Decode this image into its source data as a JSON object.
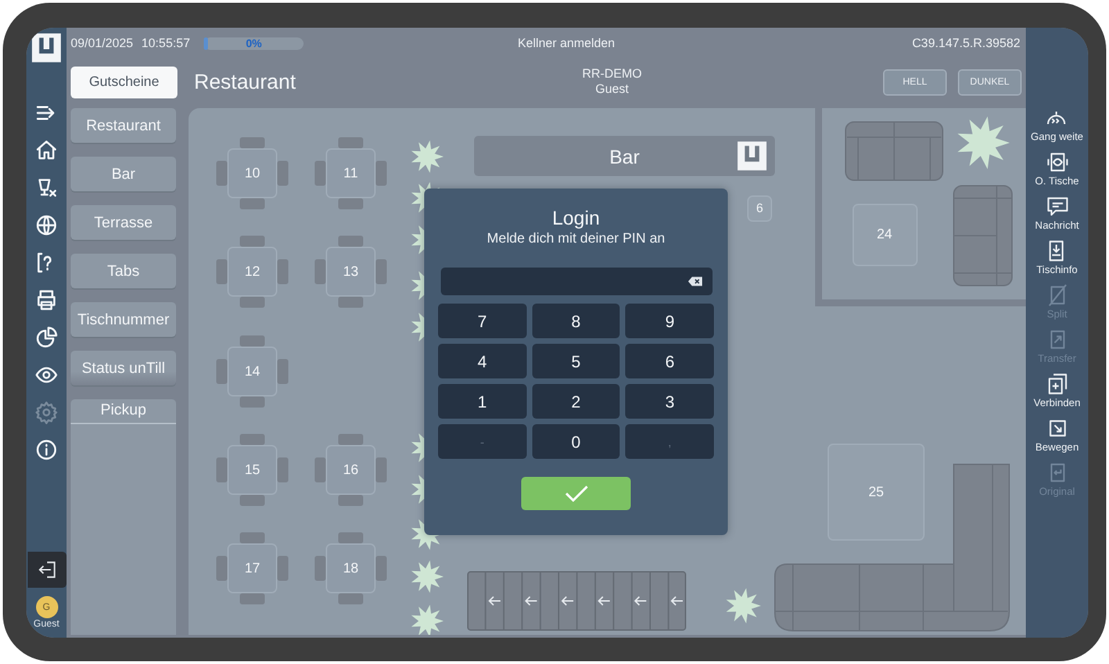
{
  "status_bar": {
    "date": "09/01/2025",
    "time": "10:55:57",
    "progress": {
      "label": "0%",
      "level": 0
    },
    "title": "Kellner anmelden",
    "version": "C39.147.5.R.39582"
  },
  "header": {
    "voucher_button": "Gutscheine",
    "area_title": "Restaurant",
    "company": "RR-DEMO",
    "user": "Guest",
    "theme_buttons": [
      {
        "label": "HELL"
      },
      {
        "label": "DUNKEL"
      }
    ]
  },
  "left_rail": {
    "items": [
      {
        "disabled": false
      },
      {
        "disabled": false
      },
      {
        "disabled": false
      },
      {
        "disabled": false
      },
      {
        "disabled": false
      },
      {
        "disabled": false
      },
      {
        "disabled": false
      },
      {
        "disabled": false
      },
      {
        "disabled": true
      },
      {
        "disabled": false
      }
    ],
    "user": {
      "initial": "G",
      "name": "Guest"
    }
  },
  "areas": [
    {
      "label": "Restaurant"
    },
    {
      "label": "Bar"
    },
    {
      "label": "Terrasse"
    },
    {
      "label": "Tabs"
    },
    {
      "label": "Tischnummer"
    },
    {
      "label": "Status unTill"
    }
  ],
  "pickup": {
    "title": "Pickup"
  },
  "floor": {
    "bar_label": "Bar",
    "tables": [
      {
        "label": "10",
        "kind": "four-seat"
      },
      {
        "label": "11",
        "kind": "four-seat"
      },
      {
        "label": "12",
        "kind": "four-seat"
      },
      {
        "label": "13",
        "kind": "four-seat"
      },
      {
        "label": "14",
        "kind": "four-seat"
      },
      {
        "label": "15",
        "kind": "four-seat"
      },
      {
        "label": "16",
        "kind": "four-seat"
      },
      {
        "label": "17",
        "kind": "four-seat"
      },
      {
        "label": "18",
        "kind": "four-seat"
      },
      {
        "label": "6",
        "kind": "small"
      },
      {
        "label": "24",
        "kind": "plain"
      },
      {
        "label": "25",
        "kind": "plain"
      }
    ]
  },
  "login": {
    "title": "Login",
    "subtitle": "Melde dich mit deiner PIN an",
    "keys": [
      {
        "label": "7",
        "disabled": false
      },
      {
        "label": "8",
        "disabled": false
      },
      {
        "label": "9",
        "disabled": false
      },
      {
        "label": "4",
        "disabled": false
      },
      {
        "label": "5",
        "disabled": false
      },
      {
        "label": "6",
        "disabled": false
      },
      {
        "label": "1",
        "disabled": false
      },
      {
        "label": "2",
        "disabled": false
      },
      {
        "label": "3",
        "disabled": false
      },
      {
        "label": "-",
        "disabled": true
      },
      {
        "label": "0",
        "disabled": false
      },
      {
        "label": ",",
        "disabled": true
      }
    ]
  },
  "right_rail": {
    "items": [
      {
        "label": "Gang weite",
        "disabled": false
      },
      {
        "label": "O. Tische",
        "disabled": false
      },
      {
        "label": "Nachricht",
        "disabled": false
      },
      {
        "label": "Tischinfo",
        "disabled": false
      },
      {
        "label": "Split",
        "disabled": true
      },
      {
        "label": "Transfer",
        "disabled": true
      },
      {
        "label": "Verbinden",
        "disabled": false
      },
      {
        "label": "Bewegen",
        "disabled": false
      },
      {
        "label": "Original",
        "disabled": true
      }
    ]
  }
}
